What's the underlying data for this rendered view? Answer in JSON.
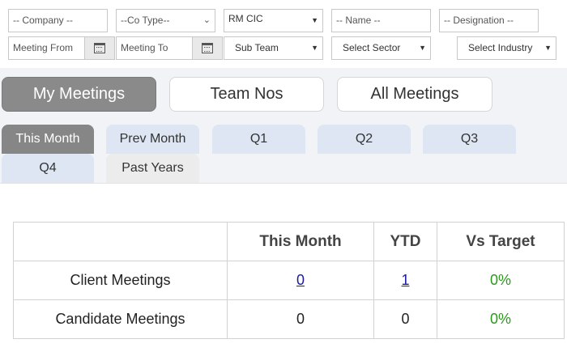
{
  "filters": {
    "company": "-- Company --",
    "co_type": "--Co Type--",
    "rm": "RM CIC",
    "name": "-- Name --",
    "designation": "-- Designation --",
    "meeting_from": "Meeting From",
    "meeting_to": "Meeting To",
    "sub_team": "Sub Team",
    "sector": "Select Sector",
    "industry": "Select Industry",
    "calendar_icon": "calendar-icon"
  },
  "view_tabs": [
    "My Meetings",
    "Team Nos",
    "All Meetings"
  ],
  "period_tabs": [
    "This Month",
    "Prev Month",
    "Q1",
    "Q2",
    "Q3",
    "Q4",
    "Past Years"
  ],
  "table": {
    "headers": [
      "",
      "This Month",
      "YTD",
      "Vs Target"
    ],
    "rows": [
      {
        "label": "Client Meetings",
        "this_month": "0",
        "ytd": "1",
        "vs_target": "0%"
      },
      {
        "label": "Candidate Meetings",
        "this_month": "0",
        "ytd": "0",
        "vs_target": "0%"
      }
    ]
  },
  "colors": {
    "active_tab": "#8a8a8a",
    "period_tab": "#dde6f2",
    "link": "#1a1aa6",
    "target_green": "#2a9a1c"
  }
}
